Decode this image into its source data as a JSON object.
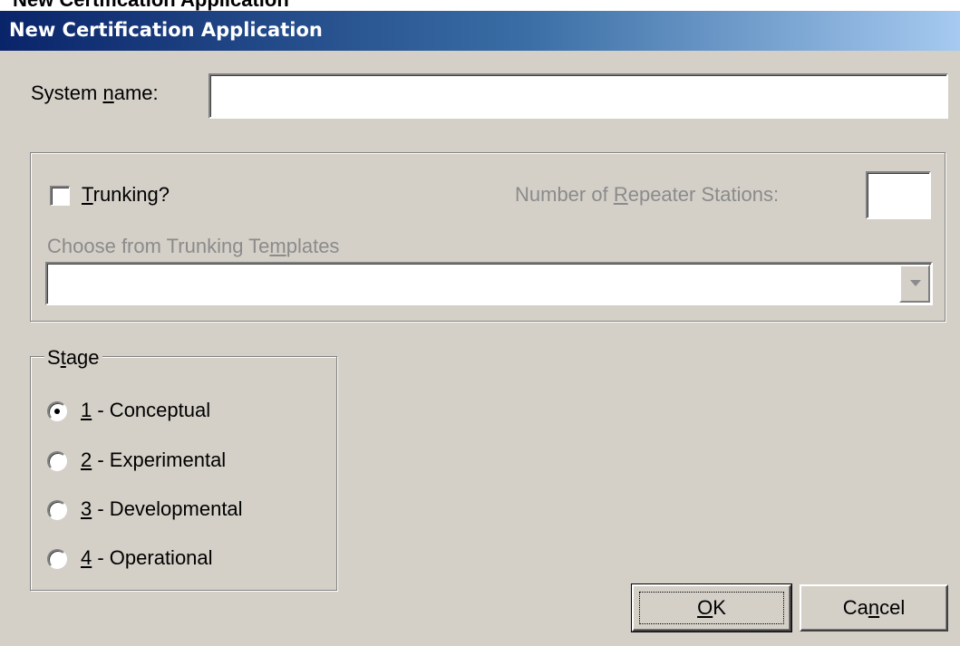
{
  "outer_window": {
    "title": "New Certification Application"
  },
  "dialog": {
    "title": "New Certification Application"
  },
  "system_name": {
    "label_before": "System ",
    "label_mnemonic": "n",
    "label_after": "ame:",
    "value": ""
  },
  "trunking": {
    "checkbox_mnemonic": "T",
    "checkbox_rest": "runking?",
    "checked": false,
    "repeater_label_before": "Number of ",
    "repeater_label_mnemonic": "R",
    "repeater_label_after": "epeater Stations:",
    "repeater_value": "",
    "templates_label_before": "Choose from Trunking Te",
    "templates_label_mnemonic": "m",
    "templates_label_after": "plates",
    "templates_selected": ""
  },
  "stage": {
    "legend_before": "S",
    "legend_mnemonic": "t",
    "legend_after": "age",
    "options": [
      {
        "mnemonic": "1",
        "rest": " - Conceptual",
        "selected": true
      },
      {
        "mnemonic": "2",
        "rest": " - Experimental",
        "selected": false
      },
      {
        "mnemonic": "3",
        "rest": " - Developmental",
        "selected": false
      },
      {
        "mnemonic": "4",
        "rest": " - Operational",
        "selected": false
      }
    ]
  },
  "buttons": {
    "ok_mnemonic": "O",
    "ok_rest": "K",
    "cancel_before": "Ca",
    "cancel_mnemonic": "n",
    "cancel_after": "cel"
  },
  "colors": {
    "dialog_face": "#d4d0c8",
    "title_gradient_start": "#0a246a",
    "title_gradient_end": "#a6caf0",
    "disabled_text": "#8b8b8b"
  }
}
